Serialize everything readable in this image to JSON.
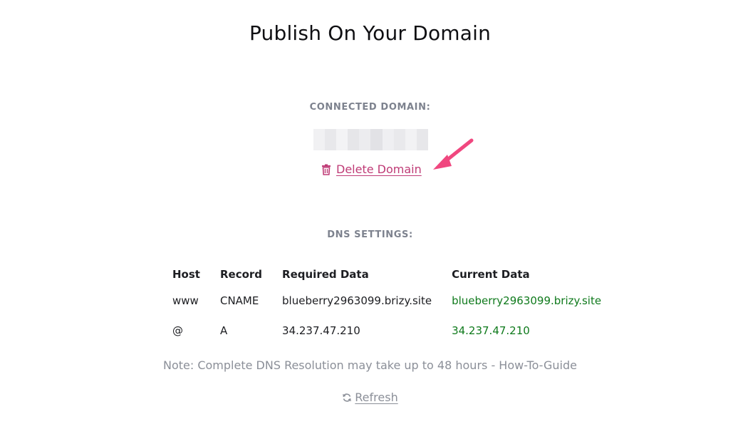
{
  "page": {
    "title": "Publish On Your Domain"
  },
  "connected_domain": {
    "label": "CONNECTED DOMAIN:",
    "delete_label": "Delete Domain",
    "delete_icon": "trash-icon",
    "accent_color": "#bf3b76"
  },
  "dns": {
    "label": "DNS SETTINGS:",
    "headers": {
      "host": "Host",
      "record": "Record",
      "required": "Required Data",
      "current": "Current Data"
    },
    "rows": [
      {
        "host": "www",
        "record": "CNAME",
        "required": "blueberry2963099.brizy.site",
        "current": "blueberry2963099.brizy.site"
      },
      {
        "host": "@",
        "record": "A",
        "required": "34.237.47.210",
        "current": "34.237.47.210"
      }
    ],
    "match_color": "#0f7a1c"
  },
  "note": "Note: Complete DNS Resolution may take up to 48 hours - How-To-Guide",
  "refresh": {
    "label": "Refresh",
    "icon": "refresh-icon"
  },
  "annotation": {
    "icon": "pointer-arrow-icon",
    "color": "#f0477f"
  }
}
